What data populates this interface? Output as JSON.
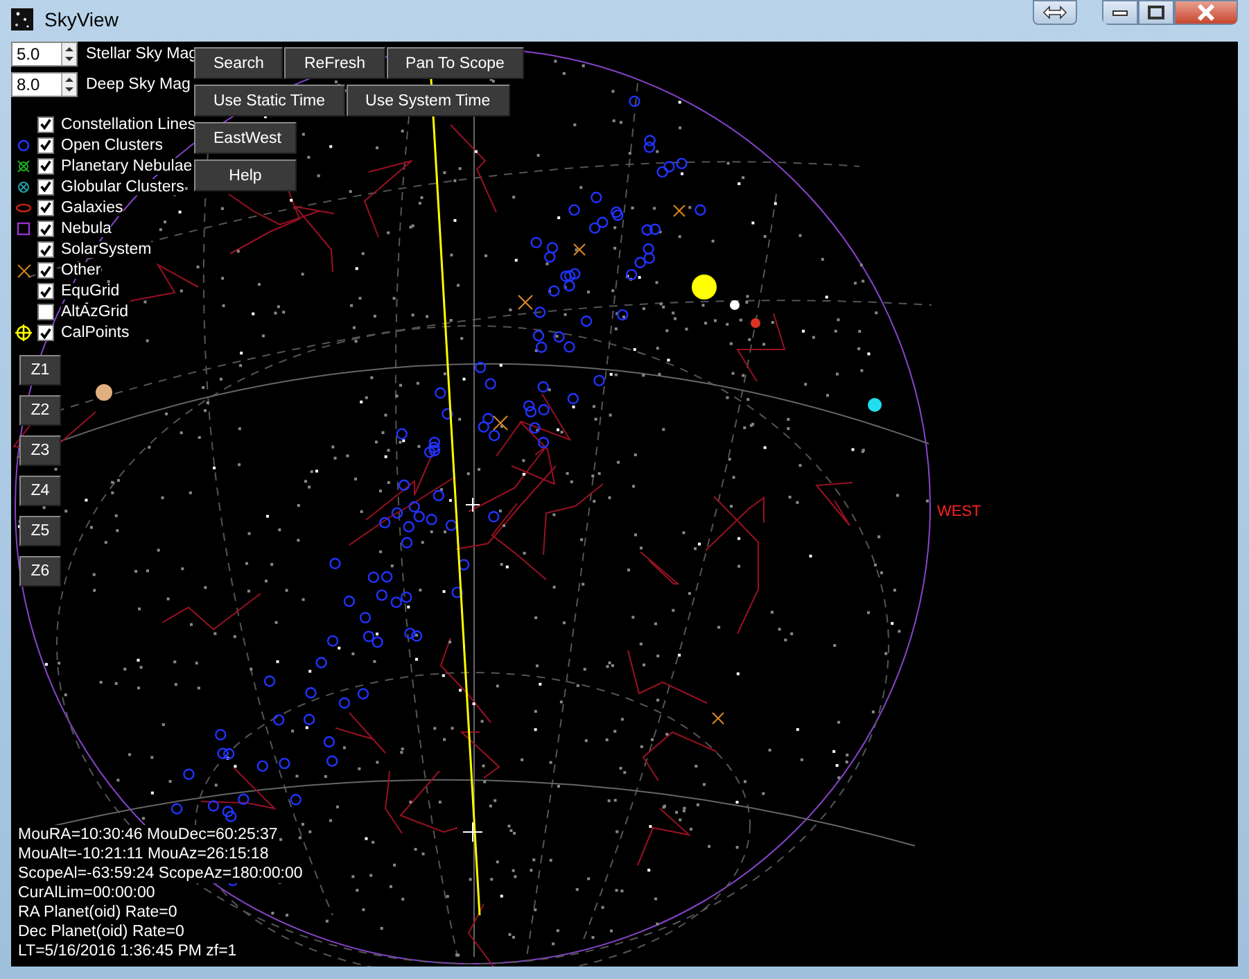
{
  "window": {
    "title": "SkyView"
  },
  "magnitudes": [
    {
      "value": "5.0",
      "label": "Stellar Sky Mag"
    },
    {
      "value": "8.0",
      "label": "Deep Sky Mag"
    }
  ],
  "button_rows": [
    [
      "Search",
      "ReFresh",
      "Pan To Scope"
    ],
    [
      "Use Static Time",
      "Use System Time"
    ],
    [
      "EastWest"
    ],
    [
      "Help"
    ]
  ],
  "layers": [
    {
      "label": "Constellation Lines",
      "checked": true,
      "kind": "none"
    },
    {
      "label": "Open Clusters",
      "checked": true,
      "kind": "circle"
    },
    {
      "label": "Planetary Nebulae",
      "checked": true,
      "kind": "planetary"
    },
    {
      "label": "Globular Clusters",
      "checked": true,
      "kind": "globular"
    },
    {
      "label": "Galaxies",
      "checked": true,
      "kind": "galaxy"
    },
    {
      "label": "Nebula",
      "checked": true,
      "kind": "square"
    },
    {
      "label": "SolarSystem",
      "checked": true,
      "kind": "none"
    },
    {
      "label": "Other",
      "checked": true,
      "kind": "cross"
    },
    {
      "label": "EquGrid",
      "checked": true,
      "kind": "none"
    },
    {
      "label": "AltAzGrid",
      "checked": false,
      "kind": "none"
    },
    {
      "label": "CalPoints",
      "checked": true,
      "kind": "crosshair"
    }
  ],
  "zoom_buttons": [
    "Z1",
    "Z2",
    "Z3",
    "Z4",
    "Z5",
    "Z6"
  ],
  "compass": {
    "west": "WEST"
  },
  "status_lines": [
    "MouRA=10:30:46 MouDec=60:25:37",
    "MouAlt=-10:21:11 MouAz=26:15:18",
    "ScopeAl=-63:59:24 ScopeAz=180:00:00",
    "CurAlLim=00:00:00",
    "RA Planet(oid) Rate=0",
    "Dec Planet(oid) Rate=0",
    "LT=5/16/2016 1:36:45 PM zf=1"
  ]
}
